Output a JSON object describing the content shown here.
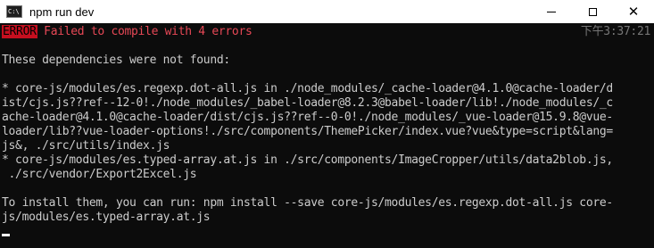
{
  "window": {
    "title": "npm run dev"
  },
  "console": {
    "error_badge": "ERROR",
    "error_message": "Failed to compile with 4 errors",
    "timestamp": "下午3:37:21",
    "lines": [
      "These dependencies were not found:",
      "* core-js/modules/es.regexp.dot-all.js in ./node_modules/_cache-loader@4.1.0@cache-loader/d",
      "ist/cjs.js??ref--12-0!./node_modules/_babel-loader@8.2.3@babel-loader/lib!./node_modules/_c",
      "ache-loader@4.1.0@cache-loader/dist/cjs.js??ref--0-0!./node_modules/_vue-loader@15.9.8@vue-",
      "loader/lib??vue-loader-options!./src/components/ThemePicker/index.vue?vue&type=script&lang=",
      "js&, ./src/utils/index.js",
      "* core-js/modules/es.typed-array.at.js in ./src/components/ImageCropper/utils/data2blob.js,",
      " ./src/vendor/Export2Excel.js",
      "To install them, you can run: npm install --save core-js/modules/es.regexp.dot-all.js core-",
      "js/modules/es.typed-array.at.js"
    ]
  }
}
